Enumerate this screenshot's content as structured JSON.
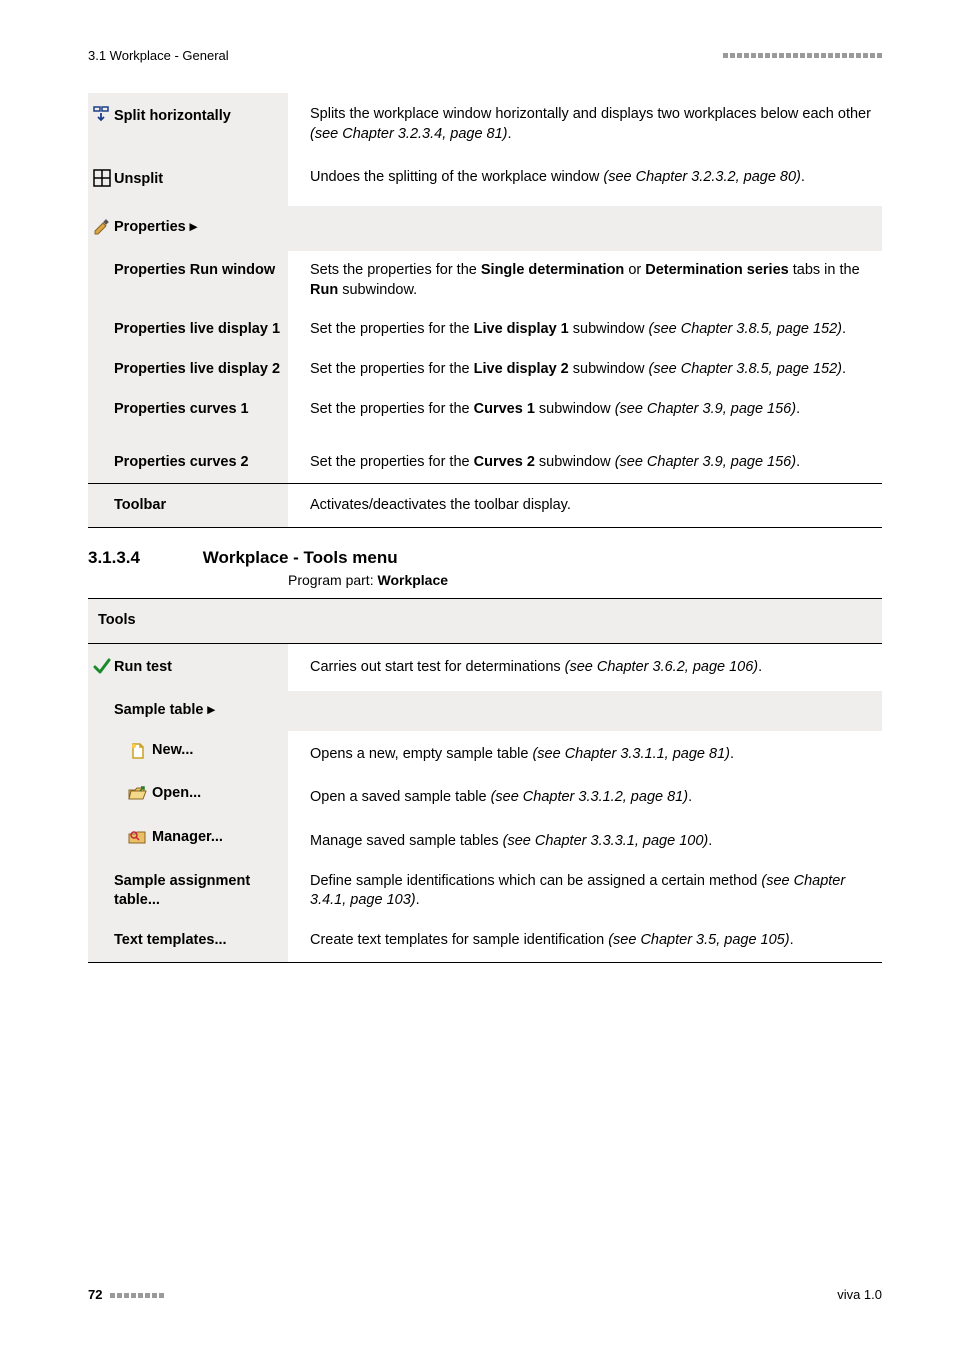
{
  "header": {
    "section": "3.1 Workplace - General"
  },
  "table1": {
    "rows": [
      {
        "icon": "split-horizontally",
        "label": "Split horizontally",
        "desc_pre": "Splits the workplace window horizontally and displays two workplaces below each other ",
        "desc_italic": "(see Chapter 3.2.3.4, page 81)",
        "desc_post": "."
      },
      {
        "icon": "unsplit",
        "label": "Unsplit",
        "desc_pre": "Undoes the splitting of the workplace window ",
        "desc_italic": "(see Chapter 3.2.3.2, page 80)",
        "desc_post": "."
      },
      {
        "icon": "properties",
        "label": "Properties ▸",
        "submenu": true
      },
      {
        "indent": true,
        "label": "Properties Run window",
        "desc_pre": "Sets the properties for the ",
        "desc_bold1": "Single determination",
        "desc_mid1": " or ",
        "desc_bold2": "Determination series",
        "desc_mid2": " tabs in the ",
        "desc_bold3": "Run",
        "desc_post": " subwindow."
      },
      {
        "indent": true,
        "label": "Properties live display 1",
        "desc_pre": "Set the properties for the ",
        "desc_bold1": "Live display 1",
        "desc_mid1": " subwindow ",
        "desc_italic": "(see Chapter 3.8.5, page 152)",
        "desc_post": "."
      },
      {
        "indent": true,
        "label": "Properties live display 2",
        "desc_pre": "Set the properties for the ",
        "desc_bold1": "Live display 2",
        "desc_mid1": " subwindow ",
        "desc_italic": "(see Chapter 3.8.5, page 152)",
        "desc_post": "."
      },
      {
        "indent": true,
        "label": "Properties curves 1",
        "desc_pre": "Set the properties for the ",
        "desc_bold1": "Curves 1",
        "desc_mid1": " subwindow ",
        "desc_italic": "(see Chapter 3.9, page 156)",
        "desc_post": "."
      },
      {
        "indent": true,
        "label": "Properties curves 2",
        "desc_pre": "Set the properties for the ",
        "desc_bold1": "Curves 2",
        "desc_mid1": " subwindow ",
        "desc_italic": "(see Chapter 3.9, page 156)",
        "desc_post": "."
      },
      {
        "label": "Toolbar",
        "desc_pre": "Activates/deactivates the toolbar display."
      }
    ]
  },
  "section": {
    "number": "3.1.3.4",
    "title": "Workplace - Tools menu",
    "program_part_label": "Program part: ",
    "program_part": "Workplace"
  },
  "table2": {
    "header": "Tools",
    "rows": [
      {
        "icon": "run-test",
        "label": "Run test",
        "desc_pre": "Carries out start test for determinations ",
        "desc_italic": "(see Chapter 3.6.2, page 106)",
        "desc_post": "."
      },
      {
        "label": "Sample table ▸"
      },
      {
        "icon": "new",
        "label": "New...",
        "desc_pre": "Opens a new, empty sample table ",
        "desc_italic": "(see Chapter 3.3.1.1, page 81)",
        "desc_post": "."
      },
      {
        "icon": "open",
        "label": "Open...",
        "desc_pre": "Open a saved sample table ",
        "desc_italic": "(see Chapter 3.3.1.2, page 81)",
        "desc_post": "."
      },
      {
        "icon": "manager",
        "label": "Manager...",
        "desc_pre": "Manage saved sample tables ",
        "desc_italic": "(see Chapter 3.3.3.1, page 100)",
        "desc_post": "."
      },
      {
        "label": "Sample assignment table...",
        "desc_pre": "Define sample identifications which can be assigned a certain method ",
        "desc_italic": "(see Chapter 3.4.1, page 103)",
        "desc_post": "."
      },
      {
        "label": "Text templates...",
        "desc_pre": "Create text templates for sample identification ",
        "desc_italic": "(see Chapter 3.5, page 105)",
        "desc_post": "."
      }
    ]
  },
  "footer": {
    "page": "72",
    "version": "viva 1.0"
  }
}
